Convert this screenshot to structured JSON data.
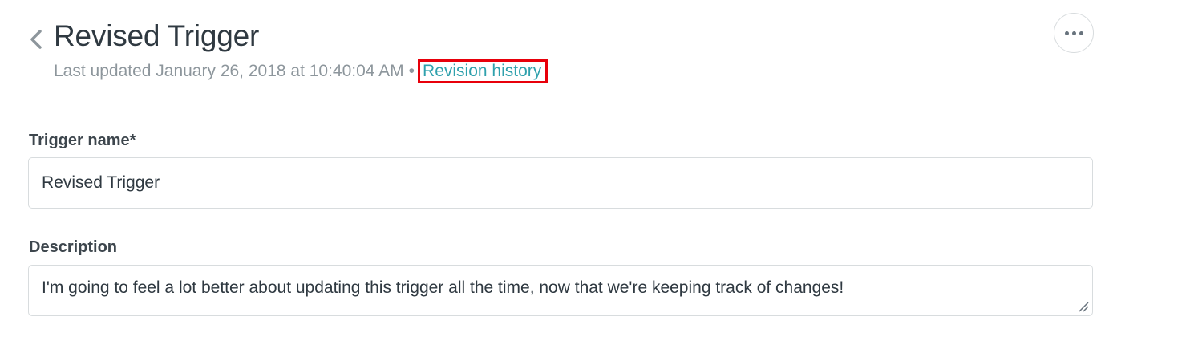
{
  "header": {
    "title": "Revised Trigger",
    "last_updated": "Last updated January 26, 2018 at 10:40:04 AM",
    "separator": "•",
    "revision_history_link": "Revision history"
  },
  "icons": {
    "back": "chevron-left-icon",
    "more": "ellipsis-icon",
    "resize": "resize-handle-icon"
  },
  "form": {
    "trigger_name_label": "Trigger name*",
    "trigger_name_value": "Revised Trigger",
    "description_label": "Description",
    "description_value": "I'm going to feel a lot better about updating this trigger all the time, now that we're keeping track of changes!"
  },
  "colors": {
    "link": "#2fa1ad",
    "highlight_box": "#e8000b",
    "title_text": "#2f3941",
    "muted_text": "#8d969c",
    "border": "#d8dcde"
  }
}
